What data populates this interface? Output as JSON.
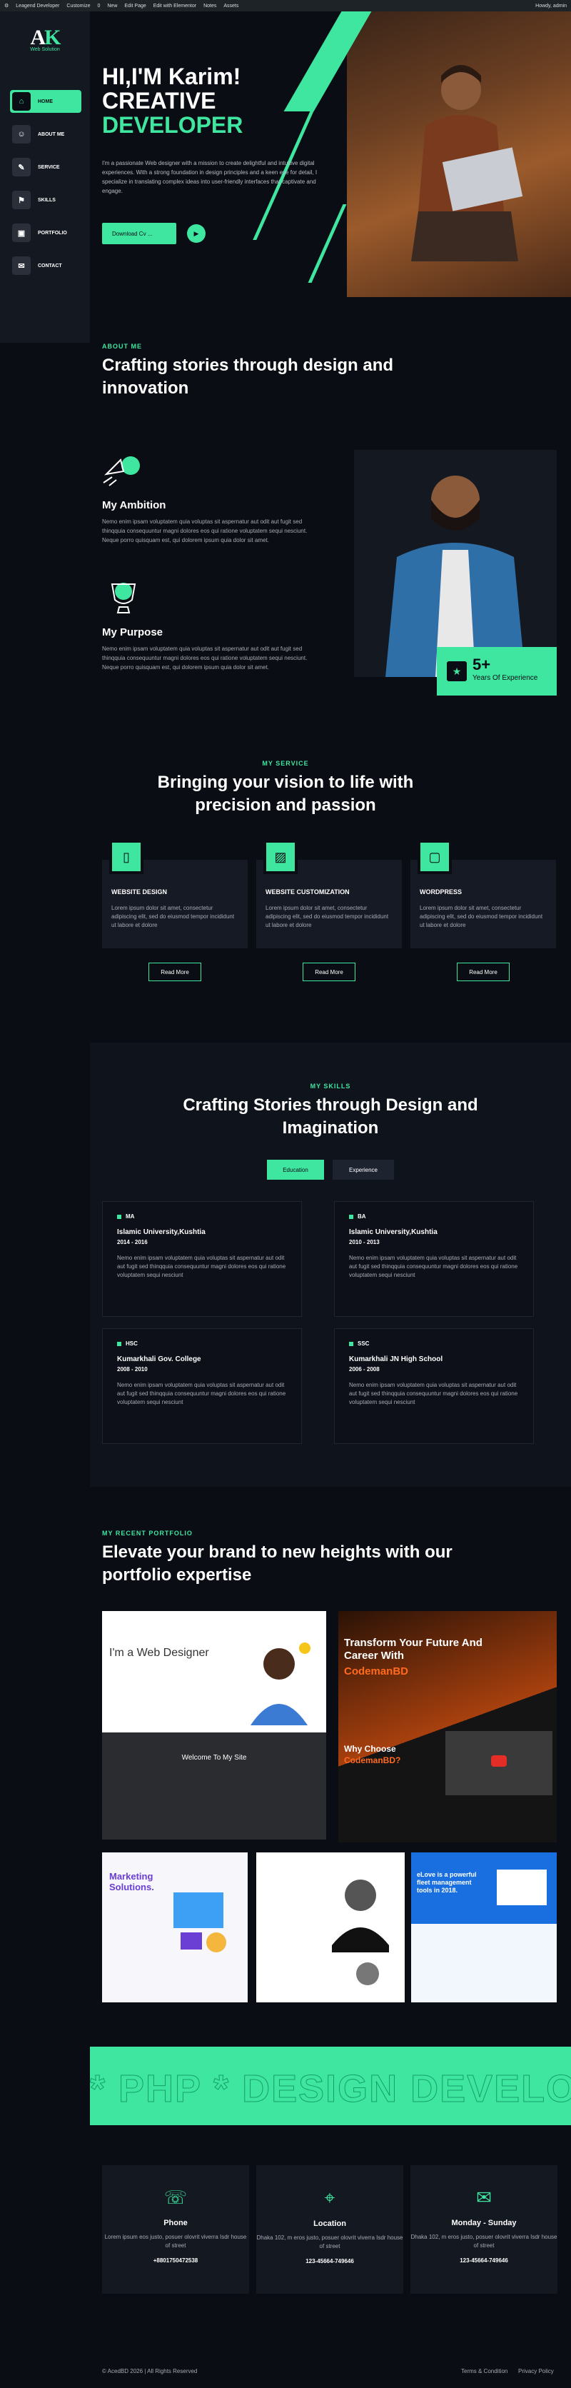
{
  "adminbar": {
    "items": [
      "Leagend Developer",
      "Customize",
      "0",
      "New",
      "Edit Page",
      "Edit with Elementor",
      "Notes",
      "Assets"
    ],
    "greeting": "Howdy, admin"
  },
  "logo": {
    "sub": "Web Solution"
  },
  "nav": [
    {
      "label": "HOME",
      "icon": "home-icon",
      "glyph": "⌂"
    },
    {
      "label": "ABOUT ME",
      "icon": "user-icon",
      "glyph": "☺"
    },
    {
      "label": "SERVICE",
      "icon": "service-icon",
      "glyph": "✎"
    },
    {
      "label": "SKILLS",
      "icon": "skills-icon",
      "glyph": "⚑"
    },
    {
      "label": "PORTFOLIO",
      "icon": "portfolio-icon",
      "glyph": "▣"
    },
    {
      "label": "CONTACT",
      "icon": "contact-icon",
      "glyph": "✉"
    }
  ],
  "hero": {
    "line1": "HI,I'M Karim!",
    "line2": "CREATIVE",
    "line3": "DEVELOPER",
    "desc": "I'm a passionate Web designer with a mission to create delightful and intuitive digital experiences. With a strong foundation in design principles and a keen eye for detail, I specialize in translating complex ideas into user-friendly interfaces that captivate and engage.",
    "cta": "Download Cv ..."
  },
  "about": {
    "label": "ABOUT ME",
    "title": "Crafting stories through design and innovation",
    "ambition_title": "My Ambition",
    "ambition_text": "Nemo enim ipsam voluptatem quia voluptas sit aspernatur aut odit aut fugit sed thinqquia consequuntur magni dolores eos qui ratione voluptatem sequi nesciunt. Neque porro quisquam est, qui dolorem ipsum quia dolor sit amet.",
    "purpose_title": "My Purpose",
    "purpose_text": "Nemo enim ipsam voluptatem quia voluptas sit aspernatur aut odit aut fugit sed thinqquia consequuntur magni dolores eos qui ratione voluptatem sequi nesciunt. Neque porro quisquam est, qui dolorem ipsum quia dolor sit amet.",
    "exp_value": "5+",
    "exp_label": "Years Of Experience"
  },
  "service": {
    "label": "MY SERVICE",
    "title": "Bringing your vision to life with precision and passion",
    "cards": [
      {
        "title": "WEBSITE DESIGN",
        "text": "Lorem ipsum dolor sit amet, consectetur adipiscing elit, sed do eiusmod tempor incididunt ut labore et dolore",
        "btn": "Read More"
      },
      {
        "title": "WEBSITE CUSTOMIZATION",
        "text": "Lorem ipsum dolor sit amet, consectetur adipiscing elit, sed do eiusmod tempor incididunt ut labore et dolore",
        "btn": "Read More"
      },
      {
        "title": "WORDPRESS",
        "text": "Lorem ipsum dolor sit amet, consectetur adipiscing elit, sed do eiusmod tempor incididunt ut labore et dolore",
        "btn": "Read More"
      }
    ]
  },
  "skills": {
    "label": "MY SKILLS",
    "title": "Crafting Stories through Design and Imagination",
    "tabs": [
      "Education",
      "Experience"
    ],
    "cards": [
      {
        "degree": "MA",
        "school": "Islamic University,Kushtia",
        "year": "2014 - 2016",
        "desc": "Nemo enim ipsam voluptatem quia voluptas sit aspernatur aut odit aut fugit sed thinqquia consequuntur magni dolores eos qui ratione voluptatem sequi nesciunt"
      },
      {
        "degree": "BA",
        "school": "Islamic University,Kushtia",
        "year": "2010 - 2013",
        "desc": "Nemo enim ipsam voluptatem quia voluptas sit aspernatur aut odit aut fugit sed thinqquia consequuntur magni dolores eos qui ratione voluptatem sequi nesciunt"
      },
      {
        "degree": "HSC",
        "school": "Kumarkhali Gov. College",
        "year": "2008 - 2010",
        "desc": "Nemo enim ipsam voluptatem quia voluptas sit aspernatur aut odit aut fugit sed thinqquia consequuntur magni dolores eos qui ratione voluptatem sequi nesciunt"
      },
      {
        "degree": "SSC",
        "school": "Kumarkhali JN High School",
        "year": "2006 - 2008",
        "desc": "Nemo enim ipsam voluptatem quia voluptas sit aspernatur aut odit aut fugit sed thinqquia consequuntur magni dolores eos qui ratione voluptatem sequi nesciunt"
      }
    ]
  },
  "portfolio": {
    "label": "MY RECENT PORTFOLIO",
    "title": "Elevate your brand to new heights with our portfolio expertise",
    "p1_hi": "I'm a Web Designer",
    "p1_welcome": "Welcome To My Site",
    "p2_title": "Transform Your Future And Career With",
    "p2_brand": "CodemanBD",
    "p2_why": "Why Choose",
    "p2_why_brand": "CodemanBD?",
    "p4_title": "Marketing Solutions.",
    "p6_title": "eLove is a powerful fleet management tools in 2018."
  },
  "marquee": {
    "text": "* PHP * DESIGN DEVELOPMENT * PHP * DESIGN"
  },
  "contact": [
    {
      "title": "Phone",
      "text": "Lorem ipsum eos justo, posuer olovrit viverra Isdr house of street",
      "value": "+8801750472538",
      "icon": "phone-icon"
    },
    {
      "title": "Location",
      "text": "Dhaka 102, m eros justo, posuer olovrit viverra Isdr house of street",
      "value": "123-45664-749646",
      "icon": "map-icon"
    },
    {
      "title": "Monday - Sunday",
      "text": "Dhaka 102, m eros justo, posuer olovrit viverra Isdr house of street",
      "value": "123-45664-749646",
      "icon": "mail-icon"
    }
  ],
  "footer": {
    "copyright": "© AcedBD 2026 | All Rights Reserved",
    "terms": "Terms & Condition",
    "privacy": "Privacy Policy"
  },
  "colors": {
    "accent": "#3ee6a0",
    "bg": "#0b0d14",
    "card": "#141821"
  }
}
